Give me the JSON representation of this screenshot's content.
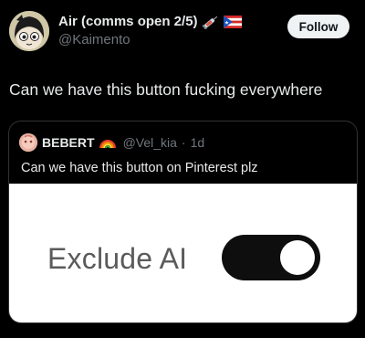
{
  "post": {
    "author_name": "Air (comms open 2/5)",
    "handle": "@Kaimento",
    "follow_label": "Follow",
    "text": "Can we have this button fucking everywhere",
    "author_emojis": [
      "syringe-emoji",
      "puerto-rico-flag-emoji"
    ]
  },
  "quote": {
    "author_name": "BEBERT",
    "author_emoji": "rainbow-emoji",
    "handle": "@Vel_kia",
    "separator": "·",
    "time": "1d",
    "text": "Can we have this button on Pinterest plz",
    "image": {
      "label": "Exclude AI",
      "toggle_on": true
    }
  }
}
